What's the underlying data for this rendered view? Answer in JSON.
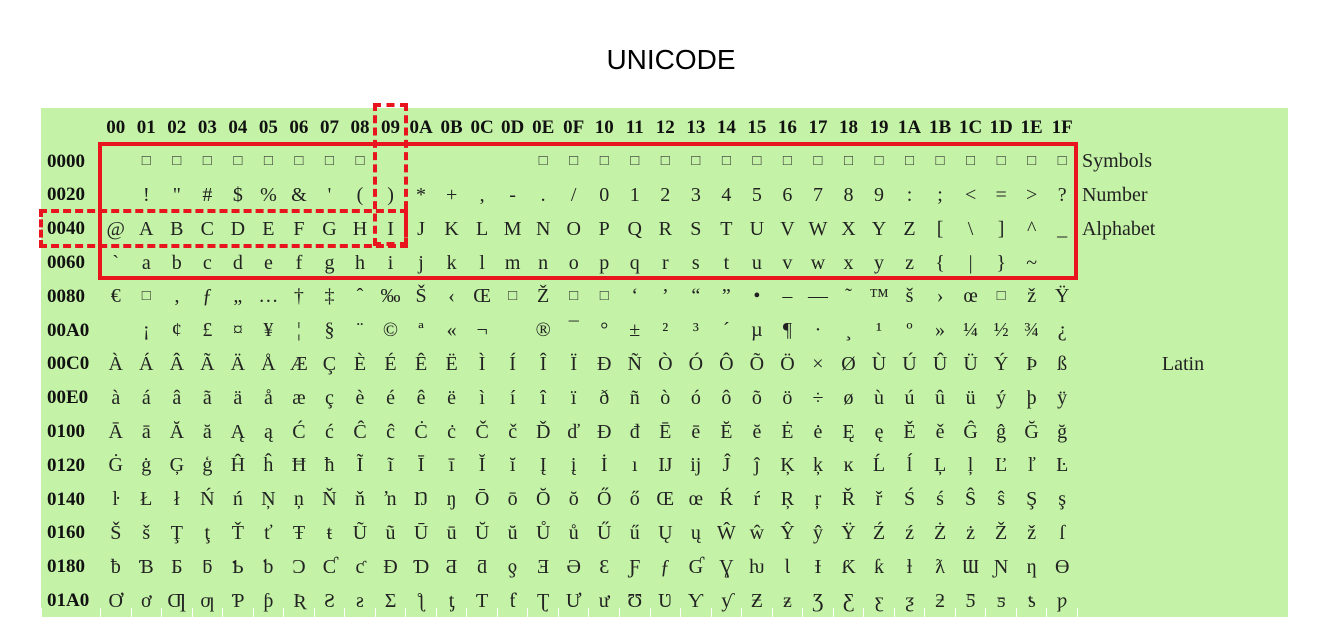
{
  "title": "UNICODE",
  "columns": [
    "00",
    "01",
    "02",
    "03",
    "04",
    "05",
    "06",
    "07",
    "08",
    "09",
    "0A",
    "0B",
    "0C",
    "0D",
    "0E",
    "0F",
    "10",
    "11",
    "12",
    "13",
    "14",
    "15",
    "16",
    "17",
    "18",
    "19",
    "1A",
    "1B",
    "1C",
    "1D",
    "1E",
    "1F"
  ],
  "rows": [
    {
      "label": "0000",
      "cells": [
        "",
        "□",
        "□",
        "□",
        "□",
        "□",
        "□",
        "□",
        "□",
        "",
        "",
        "",
        "",
        "",
        "□",
        "□",
        "□",
        "□",
        "□",
        "□",
        "□",
        "□",
        "□",
        "□",
        "□",
        "□",
        "□",
        "□",
        "□",
        "□",
        "□",
        "□"
      ]
    },
    {
      "label": "0020",
      "cells": [
        "",
        "!",
        "\"",
        "#",
        "$",
        "%",
        "&",
        "'",
        "(",
        ")",
        "*",
        "+",
        ",",
        "-",
        ".",
        "/",
        "0",
        "1",
        "2",
        "3",
        "4",
        "5",
        "6",
        "7",
        "8",
        "9",
        ":",
        ";",
        "<",
        "=",
        ">",
        "?"
      ]
    },
    {
      "label": "0040",
      "cells": [
        "@",
        "A",
        "B",
        "C",
        "D",
        "E",
        "F",
        "G",
        "H",
        "I",
        "J",
        "K",
        "L",
        "M",
        "N",
        "O",
        "P",
        "Q",
        "R",
        "S",
        "T",
        "U",
        "V",
        "W",
        "X",
        "Y",
        "Z",
        "[",
        "\\",
        "]",
        "^",
        "_"
      ]
    },
    {
      "label": "0060",
      "cells": [
        "`",
        "a",
        "b",
        "c",
        "d",
        "e",
        "f",
        "g",
        "h",
        "i",
        "j",
        "k",
        "l",
        "m",
        "n",
        "o",
        "p",
        "q",
        "r",
        "s",
        "t",
        "u",
        "v",
        "w",
        "x",
        "y",
        "z",
        "{",
        "|",
        "}",
        "~",
        ""
      ]
    },
    {
      "label": "0080",
      "cells": [
        "€",
        "□",
        "‚",
        "ƒ",
        "„",
        "…",
        "†",
        "‡",
        "ˆ",
        "‰",
        "Š",
        "‹",
        "Œ",
        "□",
        "Ž",
        "□",
        "□",
        "‘",
        "’",
        "“",
        "”",
        "•",
        "–",
        "—",
        "˜",
        "™",
        "š",
        "›",
        "œ",
        "□",
        "ž",
        "Ÿ"
      ]
    },
    {
      "label": "00A0",
      "cells": [
        "",
        "¡",
        "¢",
        "£",
        "¤",
        "¥",
        "¦",
        "§",
        "¨",
        "©",
        "ª",
        "«",
        "¬",
        "",
        "®",
        "¯",
        "°",
        "±",
        "²",
        "³",
        "´",
        "µ",
        "¶",
        "·",
        "¸",
        "¹",
        "º",
        "»",
        "¼",
        "½",
        "¾",
        "¿"
      ]
    },
    {
      "label": "00C0",
      "cells": [
        "À",
        "Á",
        "Â",
        "Ã",
        "Ä",
        "Å",
        "Æ",
        "Ç",
        "È",
        "É",
        "Ê",
        "Ë",
        "Ì",
        "Í",
        "Î",
        "Ï",
        "Ð",
        "Ñ",
        "Ò",
        "Ó",
        "Ô",
        "Õ",
        "Ö",
        "×",
        "Ø",
        "Ù",
        "Ú",
        "Û",
        "Ü",
        "Ý",
        "Þ",
        "ß"
      ]
    },
    {
      "label": "00E0",
      "cells": [
        "à",
        "á",
        "â",
        "ã",
        "ä",
        "å",
        "æ",
        "ç",
        "è",
        "é",
        "ê",
        "ë",
        "ì",
        "í",
        "î",
        "ï",
        "ð",
        "ñ",
        "ò",
        "ó",
        "ô",
        "õ",
        "ö",
        "÷",
        "ø",
        "ù",
        "ú",
        "û",
        "ü",
        "ý",
        "þ",
        "ÿ"
      ]
    },
    {
      "label": "0100",
      "cells": [
        "Ā",
        "ā",
        "Ă",
        "ă",
        "Ą",
        "ą",
        "Ć",
        "ć",
        "Ĉ",
        "ĉ",
        "Ċ",
        "ċ",
        "Č",
        "č",
        "Ď",
        "ď",
        "Đ",
        "đ",
        "Ē",
        "ē",
        "Ĕ",
        "ĕ",
        "Ė",
        "ė",
        "Ę",
        "ę",
        "Ě",
        "ě",
        "Ĝ",
        "ĝ",
        "Ğ",
        "ğ"
      ]
    },
    {
      "label": "0120",
      "cells": [
        "Ġ",
        "ġ",
        "Ģ",
        "ģ",
        "Ĥ",
        "ĥ",
        "Ħ",
        "ħ",
        "Ĩ",
        "ĩ",
        "Ī",
        "ī",
        "Ĭ",
        "ĭ",
        "Į",
        "į",
        "İ",
        "ı",
        "Ĳ",
        "ĳ",
        "Ĵ",
        "ĵ",
        "Ķ",
        "ķ",
        "ĸ",
        "Ĺ",
        "ĺ",
        "Ļ",
        "ļ",
        "Ľ",
        "ľ",
        "Ŀ"
      ]
    },
    {
      "label": "0140",
      "cells": [
        "ŀ",
        "Ł",
        "ł",
        "Ń",
        "ń",
        "Ņ",
        "ņ",
        "Ň",
        "ň",
        "ŉ",
        "Ŋ",
        "ŋ",
        "Ō",
        "ō",
        "Ŏ",
        "ŏ",
        "Ő",
        "ő",
        "Œ",
        "œ",
        "Ŕ",
        "ŕ",
        "Ŗ",
        "ŗ",
        "Ř",
        "ř",
        "Ś",
        "ś",
        "Ŝ",
        "ŝ",
        "Ş",
        "ş"
      ]
    },
    {
      "label": "0160",
      "cells": [
        "Š",
        "š",
        "Ţ",
        "ţ",
        "Ť",
        "ť",
        "Ŧ",
        "ŧ",
        "Ũ",
        "ũ",
        "Ū",
        "ū",
        "Ŭ",
        "ŭ",
        "Ů",
        "ů",
        "Ű",
        "ű",
        "Ų",
        "ų",
        "Ŵ",
        "ŵ",
        "Ŷ",
        "ŷ",
        "Ÿ",
        "Ź",
        "ź",
        "Ż",
        "ż",
        "Ž",
        "ž",
        "ſ"
      ]
    },
    {
      "label": "0180",
      "cells": [
        "ƀ",
        "Ɓ",
        "Ƃ",
        "ƃ",
        "Ƅ",
        "ƅ",
        "Ɔ",
        "Ƈ",
        "ƈ",
        "Ɖ",
        "Ɗ",
        "Ƌ",
        "ƌ",
        "ƍ",
        "Ǝ",
        "Ə",
        "Ɛ",
        "Ƒ",
        "ƒ",
        "Ɠ",
        "Ɣ",
        "ƕ",
        "Ɩ",
        "Ɨ",
        "Ƙ",
        "ƙ",
        "ƚ",
        "ƛ",
        "Ɯ",
        "Ɲ",
        "ƞ",
        "Ɵ"
      ]
    },
    {
      "label": "01A0",
      "cells": [
        "Ơ",
        "ơ",
        "Ƣ",
        "ƣ",
        "Ƥ",
        "ƥ",
        "Ʀ",
        "Ƨ",
        "ƨ",
        "Ʃ",
        "ƪ",
        "ƫ",
        "Ƭ",
        "ƭ",
        "Ʈ",
        "Ư",
        "ư",
        "Ʊ",
        "Ʋ",
        "Ƴ",
        "ƴ",
        "Ƶ",
        "ƶ",
        "Ʒ",
        "Ƹ",
        "ƹ",
        "ƺ",
        "ƻ",
        "Ƽ",
        "ƽ",
        "ƾ",
        "ƿ"
      ]
    }
  ],
  "categories": {
    "symbols": "Symbols",
    "number": "Number",
    "alphabet": "Alphabet",
    "latin": "Latin"
  },
  "colors": {
    "grid": "#c4f2a6",
    "highlight": "#e8141e"
  }
}
